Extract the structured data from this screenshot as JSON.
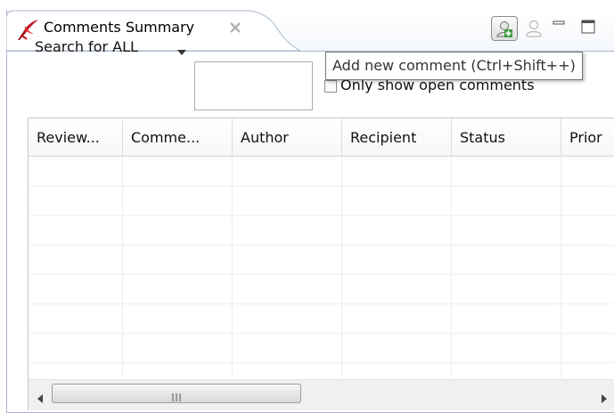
{
  "view": {
    "tab_title": "Comments Summary",
    "tab_icon": "reviews-quill-icon",
    "tab_close_icon": "close-icon"
  },
  "toolbar": {
    "add_icon": "add-comment-icon",
    "remove_icon": "remove-comment-icon",
    "minimize_icon": "minimize-icon",
    "maximize_icon": "maximize-icon"
  },
  "tooltip": {
    "text": "Add new comment (Ctrl+Shift++)"
  },
  "search": {
    "label": "Search for ALL",
    "value": "",
    "dropdown_icon": "dropdown-arrow-icon"
  },
  "filter": {
    "open_only_label": "Only show open comments",
    "open_only_checked": false
  },
  "table": {
    "columns": [
      "Review...",
      "Comme...",
      "Author",
      "Recipient",
      "Status",
      "Prior"
    ],
    "rows": []
  },
  "colors": {
    "frame_border": "#a9b8cf",
    "grid_line": "#ededed",
    "tooltip_border": "#767676"
  }
}
